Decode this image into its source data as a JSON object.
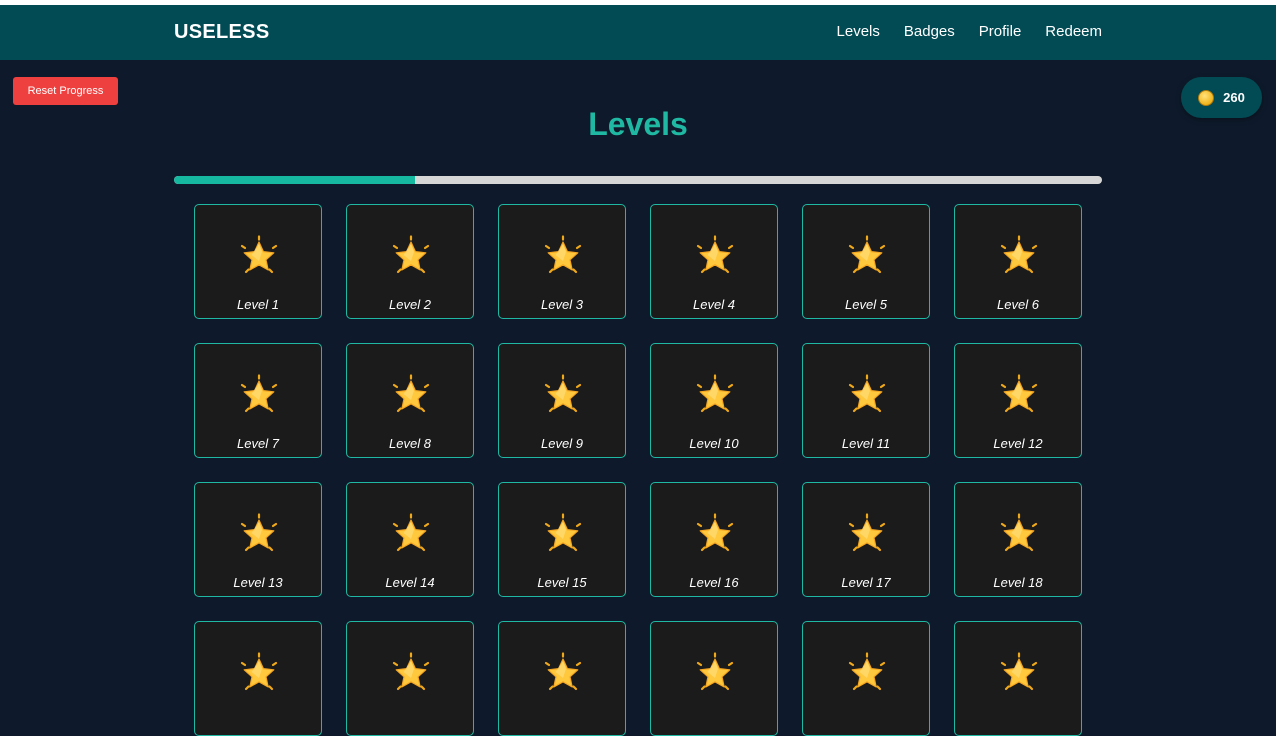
{
  "header": {
    "brand": "USELESS",
    "nav": [
      "Levels",
      "Badges",
      "Profile",
      "Redeem"
    ]
  },
  "reset_button": {
    "label": "Reset Progress"
  },
  "coins": {
    "icon": "coin-icon",
    "count": "260"
  },
  "main": {
    "title": "Levels",
    "progress_fraction": 0.26
  },
  "levels": [
    {
      "label": "Level 1",
      "icon": "star-icon"
    },
    {
      "label": "Level 2",
      "icon": "star-icon"
    },
    {
      "label": "Level 3",
      "icon": "star-icon"
    },
    {
      "label": "Level 4",
      "icon": "star-icon"
    },
    {
      "label": "Level 5",
      "icon": "star-icon"
    },
    {
      "label": "Level 6",
      "icon": "star-icon"
    },
    {
      "label": "Level 7",
      "icon": "star-icon"
    },
    {
      "label": "Level 8",
      "icon": "star-icon"
    },
    {
      "label": "Level 9",
      "icon": "star-icon"
    },
    {
      "label": "Level 10",
      "icon": "star-icon"
    },
    {
      "label": "Level 11",
      "icon": "star-icon"
    },
    {
      "label": "Level 12",
      "icon": "star-icon"
    },
    {
      "label": "Level 13",
      "icon": "star-icon"
    },
    {
      "label": "Level 14",
      "icon": "star-icon"
    },
    {
      "label": "Level 15",
      "icon": "star-icon"
    },
    {
      "label": "Level 16",
      "icon": "star-icon"
    },
    {
      "label": "Level 17",
      "icon": "star-icon"
    },
    {
      "label": "Level 18",
      "icon": "star-icon"
    },
    {
      "label": "",
      "icon": "star-icon"
    },
    {
      "label": "",
      "icon": "star-icon"
    },
    {
      "label": "",
      "icon": "star-icon"
    },
    {
      "label": "",
      "icon": "star-icon"
    },
    {
      "label": "",
      "icon": "star-icon"
    },
    {
      "label": "",
      "icon": "star-icon"
    }
  ],
  "colors": {
    "background": "#0e1a2b",
    "navbar": "#024b54",
    "accent": "#1fb8a2",
    "reset": "#ef4040",
    "card": "#1b1b1c",
    "star": "#ffc83d"
  }
}
